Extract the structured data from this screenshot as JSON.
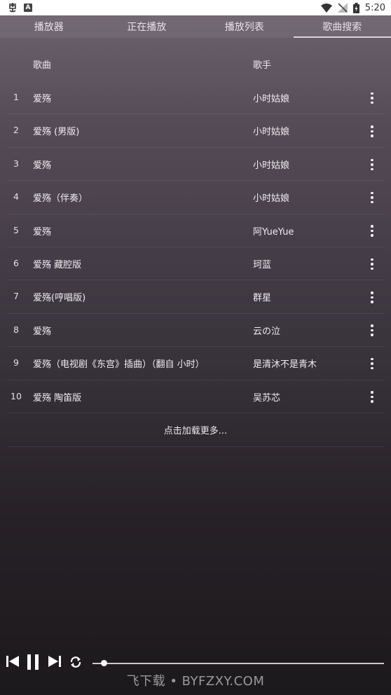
{
  "status_bar": {
    "left_icons": [
      "app-logo-icon",
      "keyboard-a-icon"
    ],
    "right_icons": [
      "wifi-icon",
      "no-signal-icon",
      "battery-icon"
    ],
    "time": "5:20"
  },
  "tabs": [
    {
      "label": "播放器",
      "active": false
    },
    {
      "label": "正在播放",
      "active": false
    },
    {
      "label": "播放列表",
      "active": false
    },
    {
      "label": "歌曲搜索",
      "active": true
    }
  ],
  "list_header": {
    "song": "歌曲",
    "artist": "歌手"
  },
  "songs": [
    {
      "num": "1",
      "title": "爱殇",
      "artist": "小时姑娘"
    },
    {
      "num": "2",
      "title": "爱殇 (男版)",
      "artist": "小时姑娘"
    },
    {
      "num": "3",
      "title": "爱殇",
      "artist": "小时姑娘"
    },
    {
      "num": "4",
      "title": "爱殇（伴奏）",
      "artist": "小时姑娘"
    },
    {
      "num": "5",
      "title": "爱殇",
      "artist": "阿YueYue"
    },
    {
      "num": "6",
      "title": "爱殇 藏腔版",
      "artist": "珂蓝"
    },
    {
      "num": "7",
      "title": "爱殇(哼唱版)",
      "artist": "群星"
    },
    {
      "num": "8",
      "title": "爱殇",
      "artist": "云の泣"
    },
    {
      "num": "9",
      "title": "爱殇（电视剧《东宫》插曲）（翻自 小时）",
      "artist": "是清沐不是青木"
    },
    {
      "num": "10",
      "title": "爱殇 陶笛版",
      "artist": "吴苏芯"
    }
  ],
  "load_more": "点击加载更多...",
  "player": {
    "icons": [
      "previous-icon",
      "pause-icon",
      "next-icon",
      "repeat-icon"
    ],
    "progress": 0.04
  },
  "watermark": "飞下载 • BYFZXY.COM"
}
